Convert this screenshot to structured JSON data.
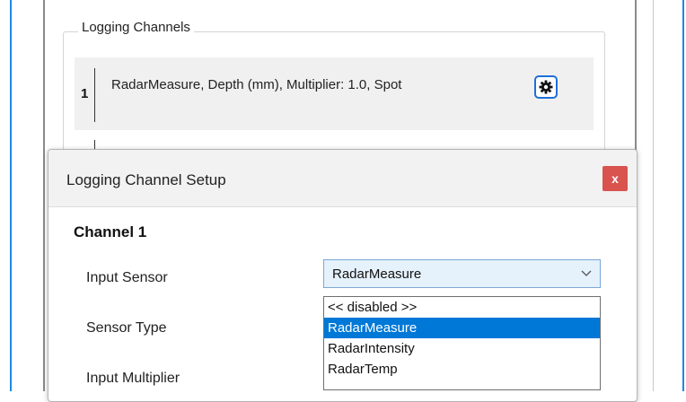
{
  "logging_group": {
    "title": "Logging Channels",
    "channels": [
      {
        "number": "1",
        "description": "RadarMeasure, Depth (mm), Multiplier: 1.0, Spot",
        "settings_icon": "gear-icon"
      }
    ]
  },
  "dialog": {
    "title": "Logging Channel Setup",
    "close_label": "x",
    "section_title": "Channel 1",
    "fields": {
      "input_sensor": {
        "label": "Input Sensor",
        "value": "RadarMeasure"
      },
      "sensor_type": {
        "label": "Sensor Type"
      },
      "input_multiplier": {
        "label": "Input Multiplier"
      }
    },
    "dropdown": {
      "options": [
        "<< disabled >>",
        "RadarMeasure",
        "RadarIntensity",
        "RadarTemp"
      ],
      "selected_index": 1
    }
  },
  "colors": {
    "accent": "#0078d7",
    "close_button": "#d9534f",
    "frame_border": "#1e88e5"
  }
}
